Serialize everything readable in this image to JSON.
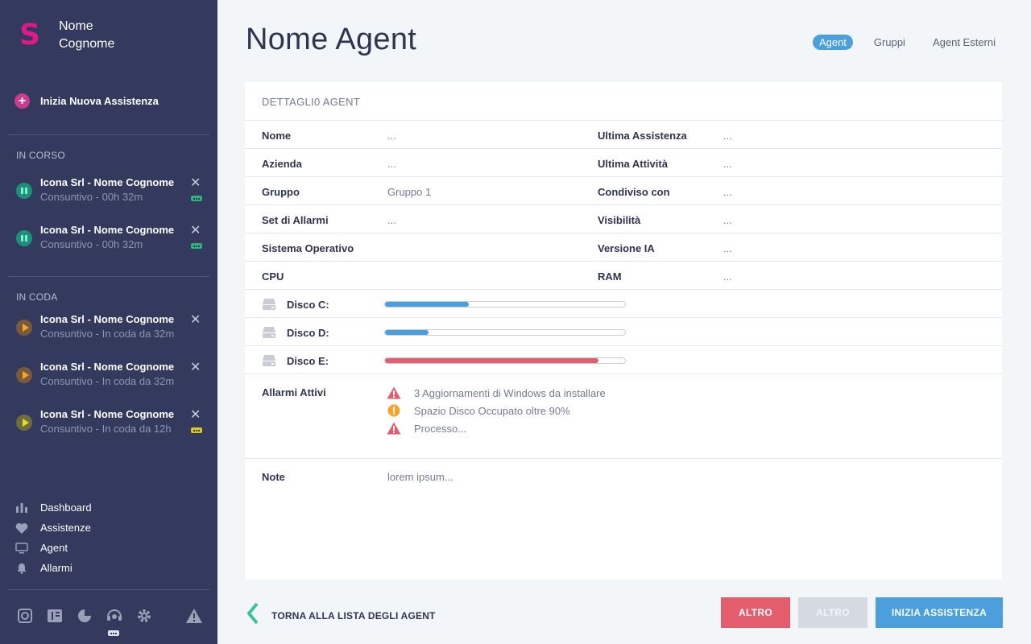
{
  "user": {
    "logo": "S",
    "first_name": "Nome",
    "last_name": "Cognome"
  },
  "sidebar": {
    "new_assist_label": "Inizia Nuova Assistenza",
    "in_progress_title": "IN CORSO",
    "queue_title": "IN CODA",
    "in_progress": [
      {
        "title": "Icona Srl - Nome Cognome",
        "subtitle": "Consuntivo - 00h 32m",
        "status": "pause"
      },
      {
        "title": "Icona Srl - Nome Cognome",
        "subtitle": "Consuntivo - 00h 32m",
        "status": "pause"
      }
    ],
    "queue": [
      {
        "title": "Icona Srl - Nome Cognome",
        "subtitle": "Consuntivo - In coda da 32m",
        "status": "play-orange"
      },
      {
        "title": "Icona Srl - Nome Cognome",
        "subtitle": "Consuntivo - In coda da 32m",
        "status": "play-orange"
      },
      {
        "title": "Icona Srl - Nome Cognome",
        "subtitle": "Consuntivo - In coda da 12h",
        "status": "play-yellow"
      }
    ],
    "nav": [
      {
        "label": "Dashboard",
        "icon": "bar-chart-icon"
      },
      {
        "label": "Assistenze",
        "icon": "heart-icon"
      },
      {
        "label": "Agent",
        "icon": "monitor-icon"
      },
      {
        "label": "Allarmi",
        "icon": "bell-icon"
      }
    ]
  },
  "header": {
    "title": "Nome Agent",
    "tabs": [
      "Agent",
      "Gruppi",
      "Agent Esterni"
    ],
    "active_tab": "Agent"
  },
  "detail": {
    "heading": "DETTAGLI0 AGENT",
    "rows": [
      {
        "l1": "Nome",
        "v1": "...",
        "l2": "Ultima Assistenza",
        "v2": "..."
      },
      {
        "l1": "Azienda",
        "v1": "...",
        "l2": "Ultima Attività",
        "v2": "..."
      },
      {
        "l1": "Gruppo",
        "v1": "Gruppo 1",
        "l2": "Condiviso con",
        "v2": "..."
      },
      {
        "l1": "Set di Allarmi",
        "v1": "...",
        "l2": "Visibilità",
        "v2": "..."
      },
      {
        "l1": "Sistema Operativo",
        "v1": "",
        "l2": "Versione IA",
        "v2": "..."
      },
      {
        "l1": "CPU",
        "v1": "",
        "l2": "RAM",
        "v2": "..."
      }
    ],
    "disks": [
      {
        "label": "Disco C:",
        "usage": 0.35,
        "color": "#4a9fdc"
      },
      {
        "label": "Disco D:",
        "usage": 0.18,
        "color": "#4a9fdc"
      },
      {
        "label": "Disco E:",
        "usage": 0.89,
        "color": "#e35d6c"
      }
    ],
    "alarms_label": "Allarmi Attivi",
    "alarms": [
      {
        "text": "3 Aggiornamenti di Windows da installare",
        "icon": "warning-triangle-icon",
        "color": "#e35d6c"
      },
      {
        "text": "Spazio Disco Occupato oltre 90%",
        "icon": "exclamation-circle-icon",
        "color": "#f4a52c"
      },
      {
        "text": "Processo...",
        "icon": "warning-triangle-icon",
        "color": "#e35d6c"
      }
    ],
    "notes_label": "Note",
    "notes_value": "lorem ipsum..."
  },
  "footer": {
    "back_label": "TORNA ALLA LISTA DEGLI AGENT",
    "btn_red": "ALTRO",
    "btn_grey": "ALTRO",
    "btn_blue": "INIZIA ASSISTENZA"
  },
  "colors": {
    "sidebar": "#333a5e",
    "accent_blue": "#4a9fdc",
    "accent_red": "#e35d6c",
    "brand_pink": "#e0198a",
    "back_arrow": "#3cc19a"
  }
}
